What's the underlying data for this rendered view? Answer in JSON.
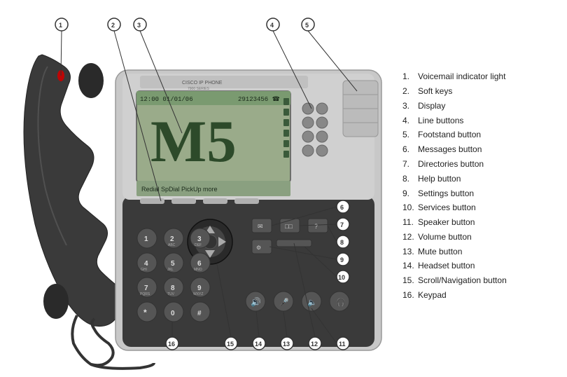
{
  "legend": {
    "items": [
      {
        "number": "1.",
        "text": "Voicemail indicator light"
      },
      {
        "number": "2.",
        "text": "Soft keys"
      },
      {
        "number": "3.",
        "text": "Display"
      },
      {
        "number": "4.",
        "text": "Line buttons"
      },
      {
        "number": "5.",
        "text": "Footstand button"
      },
      {
        "number": "6.",
        "text": "Messages button"
      },
      {
        "number": "7.",
        "text": "Directories button"
      },
      {
        "number": "8.",
        "text": "Help button"
      },
      {
        "number": "9.",
        "text": "Settings button"
      },
      {
        "number": "10.",
        "text": "Services button"
      },
      {
        "number": "11.",
        "text": "Speaker button"
      },
      {
        "number": "12.",
        "text": "Volume button"
      },
      {
        "number": "13.",
        "text": "Mute button"
      },
      {
        "number": "14.",
        "text": "Headset button"
      },
      {
        "number": "15.",
        "text": "Scroll/Navigation  button"
      },
      {
        "number": "16.",
        "text": "Keypad"
      }
    ]
  },
  "callouts": [
    {
      "id": 1,
      "label": "1"
    },
    {
      "id": 2,
      "label": "2"
    },
    {
      "id": 3,
      "label": "3"
    },
    {
      "id": 4,
      "label": "4"
    },
    {
      "id": 5,
      "label": "5"
    },
    {
      "id": 6,
      "label": "6"
    },
    {
      "id": 7,
      "label": "7"
    },
    {
      "id": 8,
      "label": "8"
    },
    {
      "id": 9,
      "label": "9"
    },
    {
      "id": 10,
      "label": "10"
    },
    {
      "id": 11,
      "label": "11"
    },
    {
      "id": 12,
      "label": "12"
    },
    {
      "id": 13,
      "label": "13"
    },
    {
      "id": 14,
      "label": "14"
    },
    {
      "id": 15,
      "label": "15"
    },
    {
      "id": 16,
      "label": "16"
    }
  ]
}
